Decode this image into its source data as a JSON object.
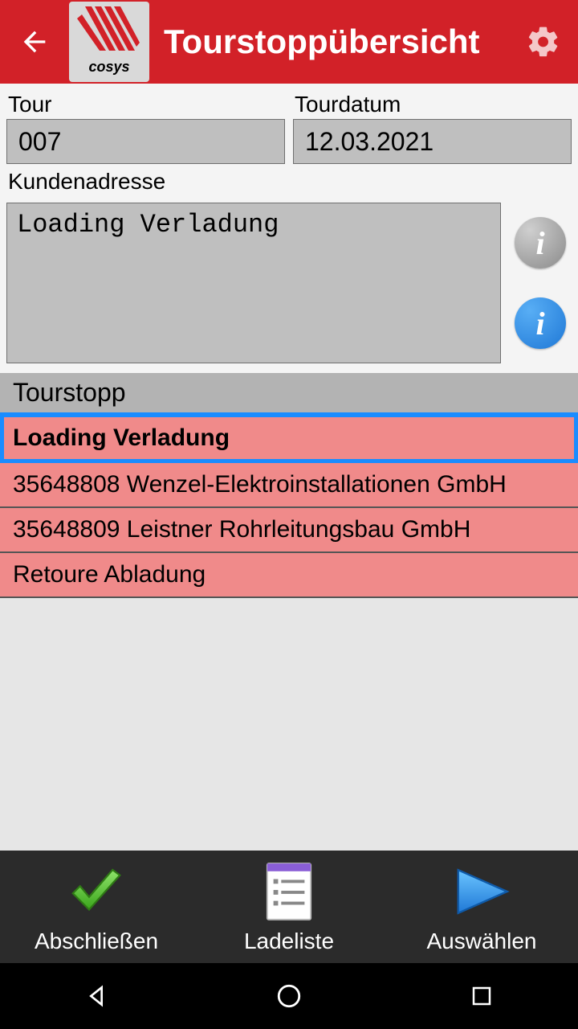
{
  "header": {
    "title": "Tourstoppübersicht",
    "logo_text": "cosys"
  },
  "form": {
    "tour_label": "Tour",
    "tour_value": "007",
    "tourdatum_label": "Tourdatum",
    "tourdatum_value": "12.03.2021",
    "kundenadresse_label": "Kundenadresse",
    "kundenadresse_value": "Loading Verladung"
  },
  "list": {
    "header": "Tourstopp",
    "items": [
      "Loading Verladung",
      "35648808 Wenzel-Elektroinstallationen GmbH",
      "35648809 Leistner Rohrleitungsbau GmbH",
      "Retoure Abladung"
    ]
  },
  "bottombar": {
    "abschliessen": "Abschließen",
    "ladeliste": "Ladeliste",
    "auswaehlen": "Auswählen"
  },
  "info_glyph": "i"
}
